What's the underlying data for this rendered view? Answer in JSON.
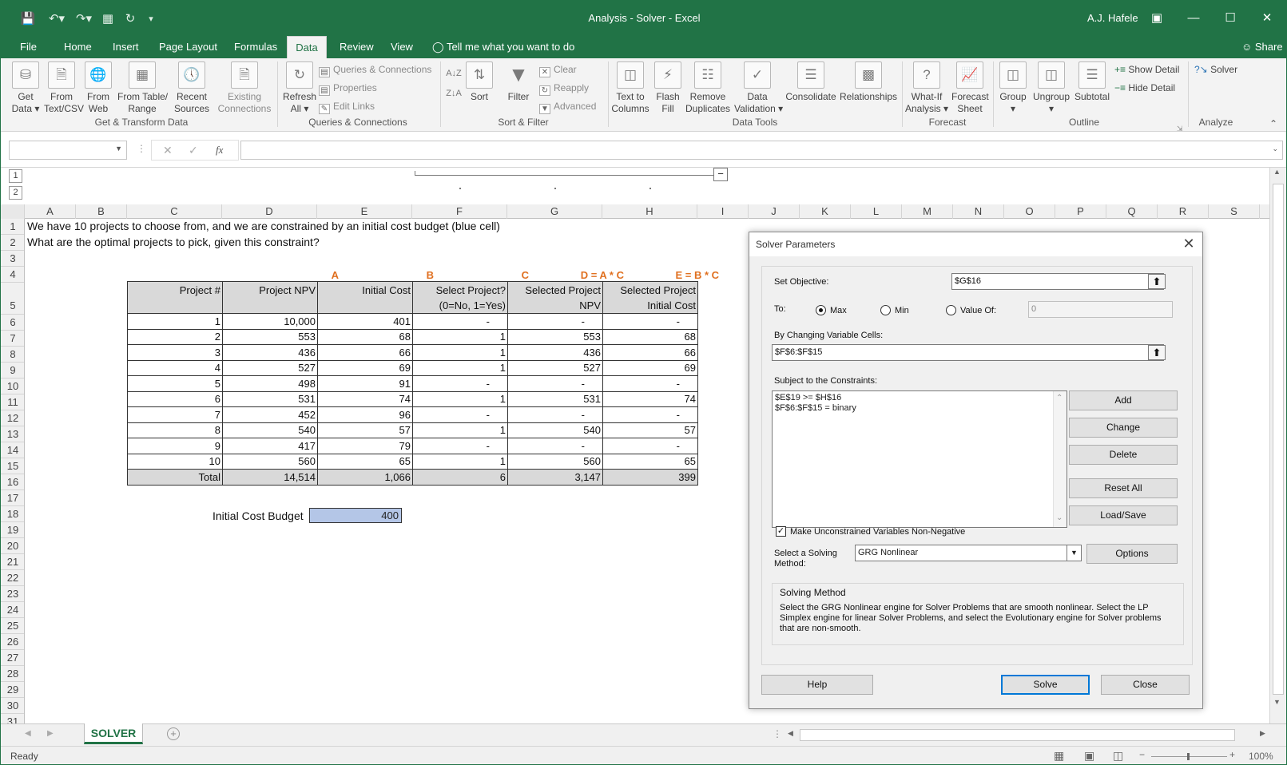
{
  "title": "Analysis - Solver  -  Excel",
  "user": "A.J. Hafele",
  "tabs": [
    "File",
    "Home",
    "Insert",
    "Page Layout",
    "Formulas",
    "Data",
    "Review",
    "View"
  ],
  "tell_me": "Tell me what you want to do",
  "share": "Share",
  "ribbon": {
    "get_data": [
      "Get",
      "Data"
    ],
    "from_text": [
      "From",
      "Text/CSV"
    ],
    "from_web": [
      "From",
      "Web"
    ],
    "from_table": [
      "From Table/",
      "Range"
    ],
    "recent_sources": [
      "Recent",
      "Sources"
    ],
    "existing_connections": [
      "Existing",
      "Connections"
    ],
    "refresh_all": [
      "Refresh",
      "All"
    ],
    "queries_connections": "Queries & Connections",
    "properties": "Properties",
    "edit_links": "Edit Links",
    "sort": "Sort",
    "filter": "Filter",
    "clear": "Clear",
    "reapply": "Reapply",
    "advanced": "Advanced",
    "text_to_columns": [
      "Text to",
      "Columns"
    ],
    "flash_fill": [
      "Flash",
      "Fill"
    ],
    "remove_duplicates": [
      "Remove",
      "Duplicates"
    ],
    "data_validation": [
      "Data",
      "Validation"
    ],
    "consolidate": "Consolidate",
    "relationships": "Relationships",
    "what_if": [
      "What-If",
      "Analysis"
    ],
    "forecast_sheet": [
      "Forecast",
      "Sheet"
    ],
    "group": "Group",
    "ungroup": "Ungroup",
    "subtotal": "Subtotal",
    "show_detail": "Show Detail",
    "hide_detail": "Hide Detail",
    "solver": "Solver",
    "groups": {
      "get_transform": "Get & Transform Data",
      "queries": "Queries & Connections",
      "sort_filter": "Sort & Filter",
      "data_tools": "Data Tools",
      "forecast": "Forecast",
      "outline": "Outline",
      "analyze": "Analyze"
    }
  },
  "outline_levels": [
    "1",
    "2"
  ],
  "columns": [
    "A",
    "B",
    "C",
    "D",
    "E",
    "F",
    "G",
    "H",
    "I",
    "J",
    "K",
    "L",
    "M",
    "N",
    "O",
    "P",
    "Q",
    "R",
    "S"
  ],
  "rows": [
    "1",
    "2",
    "3",
    "4",
    "5",
    "6",
    "7",
    "8",
    "9",
    "10",
    "11",
    "12",
    "13",
    "14",
    "15",
    "16",
    "17",
    "18",
    "19",
    "20",
    "21",
    "22",
    "23",
    "24",
    "25",
    "26",
    "27",
    "28",
    "29",
    "30",
    "31"
  ],
  "sheet": {
    "line1": "We have 10 projects to choose from, and we are constrained by an initial cost budget (blue cell)",
    "line2": "What are the optimal projects to pick, given this constraint?",
    "col_labels": [
      "A",
      "B",
      "C",
      "D = A * C",
      "E = B * C"
    ],
    "headers": [
      [
        "Project #"
      ],
      [
        "Project NPV"
      ],
      [
        "Initial Cost"
      ],
      [
        "Select Project?",
        "(0=No, 1=Yes)"
      ],
      [
        "Selected Project",
        "NPV"
      ],
      [
        "Selected Project",
        "Initial Cost"
      ]
    ],
    "table": [
      [
        "1",
        "10,000",
        "401",
        "-",
        "-",
        "-"
      ],
      [
        "2",
        "553",
        "68",
        "1",
        "553",
        "68"
      ],
      [
        "3",
        "436",
        "66",
        "1",
        "436",
        "66"
      ],
      [
        "4",
        "527",
        "69",
        "1",
        "527",
        "69"
      ],
      [
        "5",
        "498",
        "91",
        "-",
        "-",
        "-"
      ],
      [
        "6",
        "531",
        "74",
        "1",
        "531",
        "74"
      ],
      [
        "7",
        "452",
        "96",
        "-",
        "-",
        "-"
      ],
      [
        "8",
        "540",
        "57",
        "1",
        "540",
        "57"
      ],
      [
        "9",
        "417",
        "79",
        "-",
        "-",
        "-"
      ],
      [
        "10",
        "560",
        "65",
        "1",
        "560",
        "65"
      ]
    ],
    "total": [
      "Total",
      "14,514",
      "1,066",
      "6",
      "3,147",
      "399"
    ],
    "budget_label": "Initial Cost Budget",
    "budget_value": "400"
  },
  "sheet_tab": "SOLVER",
  "status": "Ready",
  "zoom": "100%",
  "dialog": {
    "title": "Solver Parameters",
    "set_objective_label": "Set Objective:",
    "objective": "$G$16",
    "to_label": "To:",
    "max": "Max",
    "min": "Min",
    "value_of": "Value Of:",
    "value_of_value": "0",
    "changing_label": "By Changing Variable Cells:",
    "changing": "$F$6:$F$15",
    "constraints_label": "Subject to the Constraints:",
    "constraints": [
      "$E$19 >= $H$16",
      "$F$6:$F$15 = binary"
    ],
    "add": "Add",
    "change": "Change",
    "delete": "Delete",
    "reset_all": "Reset All",
    "load_save": "Load/Save",
    "nonneg": "Make Unconstrained Variables Non-Negative",
    "method_label": [
      "Select a Solving",
      "Method:"
    ],
    "method": "GRG Nonlinear",
    "options": "Options",
    "sm_title": "Solving Method",
    "sm_text": "Select the GRG Nonlinear engine for Solver Problems that are smooth nonlinear. Select the LP Simplex engine for linear Solver Problems, and select the Evolutionary engine for Solver problems that are non-smooth.",
    "help": "Help",
    "solve": "Solve",
    "close": "Close"
  },
  "colors": {
    "excel_green": "#217346",
    "budget_blue": "#b4c6e7",
    "header_orange": "#e07020"
  }
}
